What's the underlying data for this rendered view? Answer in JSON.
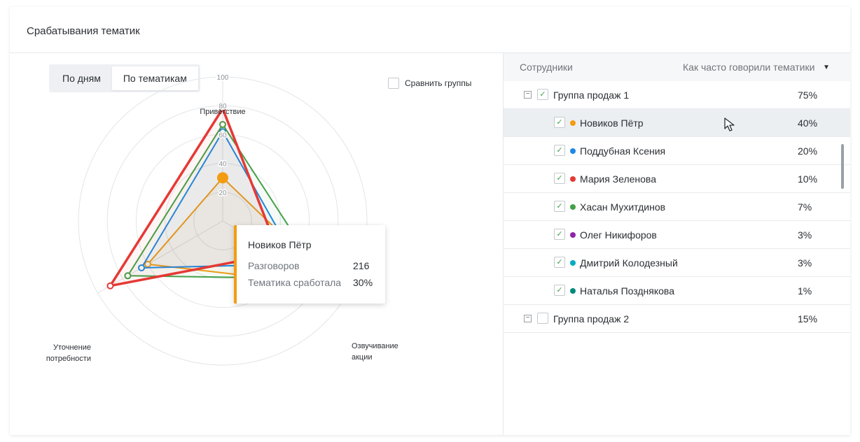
{
  "card": {
    "title": "Срабатывания тематик"
  },
  "tabs": [
    {
      "label": "По дням"
    },
    {
      "label": "По тематикам"
    }
  ],
  "compare": {
    "label": "Сравнить группы"
  },
  "tooltip": {
    "name": "Новиков Пётр",
    "rows": [
      {
        "label": "Разговоров",
        "value": "216"
      },
      {
        "label": "Тематика сработала",
        "value": "30%"
      }
    ],
    "color": "#f39c12"
  },
  "table": {
    "col_employees": "Сотрудники",
    "col_frequency": "Как часто говорили тематики",
    "sort_icon": "▼",
    "rows": [
      {
        "type": "group",
        "name": "Группа продаж 1",
        "pct": "75%",
        "checked": true
      },
      {
        "type": "person",
        "name": "Новиков Пётр",
        "pct": "40%",
        "color": "#f39c12",
        "checked": true
      },
      {
        "type": "person",
        "name": "Поддубная Ксения",
        "pct": "20%",
        "color": "#1e88e5",
        "checked": true
      },
      {
        "type": "person",
        "name": "Мария Зеленова",
        "pct": "10%",
        "color": "#e53935",
        "checked": true
      },
      {
        "type": "person",
        "name": "Хасан Мухитдинов",
        "pct": "7%",
        "color": "#43a047",
        "checked": true
      },
      {
        "type": "person",
        "name": "Олег Никифоров",
        "pct": "3%",
        "color": "#8e24aa",
        "checked": true
      },
      {
        "type": "person",
        "name": "Дмитрий Колодезный",
        "pct": "3%",
        "color": "#00acc1",
        "checked": true
      },
      {
        "type": "person",
        "name": "Наталья Позднякова",
        "pct": "1%",
        "color": "#00897b",
        "checked": true
      },
      {
        "type": "group",
        "name": "Группа продаж 2",
        "pct": "15%",
        "checked": false
      }
    ]
  },
  "chart_data": {
    "type": "radar",
    "axes": [
      "Приветствие",
      "Озвучивание акции",
      "Уточнение потребности"
    ],
    "ticks": [
      "20",
      "40",
      "60",
      "80",
      "100"
    ],
    "rmax": 100,
    "series": [
      {
        "name": "Новиков Пётр",
        "color": "#f39c12",
        "values": [
          30,
          90,
          60
        ]
      },
      {
        "name": "Поддубная Ксения",
        "color": "#1e88e5",
        "values": [
          62,
          60,
          65
        ]
      },
      {
        "name": "Хасан Мухитдинов",
        "color": "#43a047",
        "values": [
          67,
          80,
          76
        ]
      },
      {
        "name": "Мария Зеленова",
        "color": "#e53935",
        "values": [
          78,
          45,
          90
        ]
      }
    ],
    "highlight": {
      "series": "Новиков Пётр",
      "axis": "Приветствие",
      "value": 30
    }
  }
}
